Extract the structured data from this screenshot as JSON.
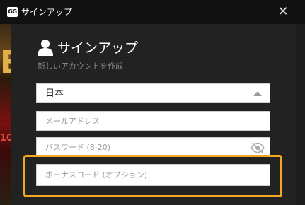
{
  "window": {
    "logo_text": "GG",
    "title": "サインアップ",
    "close_glyph": "✕"
  },
  "background": {
    "glyph": "E",
    "number": "10"
  },
  "form": {
    "heading": "サインアップ",
    "subheading": "新しいアカウントを作成",
    "country": {
      "selected": "日本"
    },
    "email": {
      "placeholder": "メールアドレス",
      "value": ""
    },
    "password": {
      "placeholder": "パスワード (8-20)",
      "value": ""
    },
    "bonus_code": {
      "placeholder": "ボーナスコード (オプション)",
      "value": ""
    }
  },
  "icons": {
    "user": "user-icon",
    "caret": "caret-up-icon",
    "eye": "eye-slash-icon",
    "close": "close-icon"
  },
  "colors": {
    "highlight": "#f5a623",
    "panel": "#222222",
    "titlebar": "#111111"
  }
}
